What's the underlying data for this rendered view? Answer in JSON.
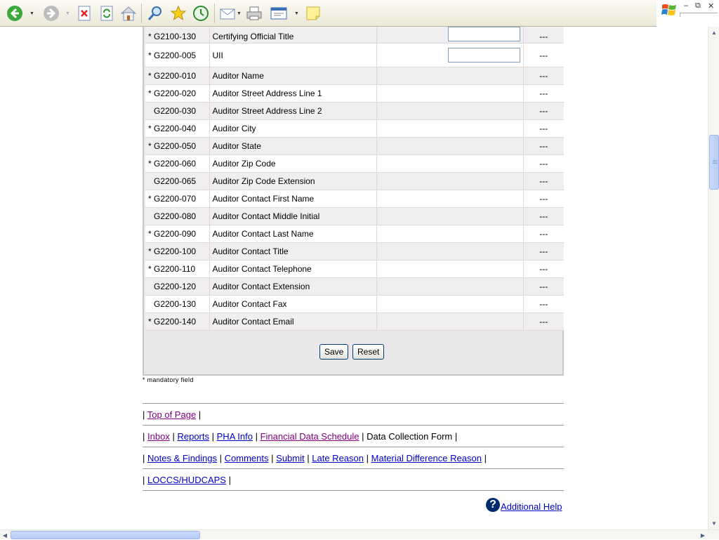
{
  "toolbar": {
    "buttons": [
      "back-icon",
      "forward-icon",
      "stop-icon",
      "refresh-icon",
      "home-icon",
      "search-icon",
      "favorites-icon",
      "history-icon",
      "mail-icon",
      "print-icon",
      "edit-icon",
      "notes-icon"
    ]
  },
  "rows": [
    {
      "code": "* G2100-130",
      "name": "Certifying Official Title",
      "input": true,
      "status": "---"
    },
    {
      "code": "* G2200-005",
      "name": "UII",
      "input": true,
      "status": "---"
    },
    {
      "code": "* G2200-010",
      "name": "Auditor Name",
      "input": false,
      "status": "---"
    },
    {
      "code": "* G2200-020",
      "name": "Auditor Street Address Line 1",
      "input": false,
      "status": "---"
    },
    {
      "code": "G2200-030",
      "name": "Auditor Street Address Line 2",
      "input": false,
      "status": "---"
    },
    {
      "code": "* G2200-040",
      "name": "Auditor City",
      "input": false,
      "status": "---"
    },
    {
      "code": "* G2200-050",
      "name": "Auditor State",
      "input": false,
      "status": "---"
    },
    {
      "code": "* G2200-060",
      "name": "Auditor Zip Code",
      "input": false,
      "status": "---"
    },
    {
      "code": "G2200-065",
      "name": "Auditor Zip Code Extension",
      "input": false,
      "status": "---"
    },
    {
      "code": "* G2200-070",
      "name": "Auditor Contact First Name",
      "input": false,
      "status": "---"
    },
    {
      "code": "G2200-080",
      "name": "Auditor Contact Middle Initial",
      "input": false,
      "status": "---"
    },
    {
      "code": "* G2200-090",
      "name": "Auditor Contact Last Name",
      "input": false,
      "status": "---"
    },
    {
      "code": "* G2200-100",
      "name": "Auditor Contact Title",
      "input": false,
      "status": "---"
    },
    {
      "code": "* G2200-110",
      "name": "Auditor Contact Telephone",
      "input": false,
      "status": "---"
    },
    {
      "code": "G2200-120",
      "name": "Auditor Contact Extension",
      "input": false,
      "status": "---"
    },
    {
      "code": "G2200-130",
      "name": "Auditor Contact Fax",
      "input": false,
      "status": "---"
    },
    {
      "code": "* G2200-140",
      "name": "Auditor Contact Email",
      "input": false,
      "status": "---"
    }
  ],
  "form": {
    "save_label": "Save",
    "reset_label": "Reset",
    "mandatory_note": "* mandatory field"
  },
  "nav": {
    "sep": "|",
    "row1": {
      "top_of_page": "Top of Page"
    },
    "row2": {
      "inbox": "Inbox",
      "reports": "Reports",
      "pha_info": "PHA Info",
      "fds": "Financial Data Schedule",
      "dcf": "Data Collection Form"
    },
    "row3": {
      "notes": "Notes & Findings",
      "comments": "Comments",
      "submit": "Submit",
      "late_reason": "Late Reason",
      "material_diff": "Material Difference Reason"
    },
    "row4": {
      "loccs": "LOCCS/HUDCAPS"
    }
  },
  "help": {
    "label": "Additional Help",
    "icon": "?"
  },
  "colors": {
    "link": "#0000cc",
    "visited": "#800080",
    "panel": "#eae7ea"
  }
}
